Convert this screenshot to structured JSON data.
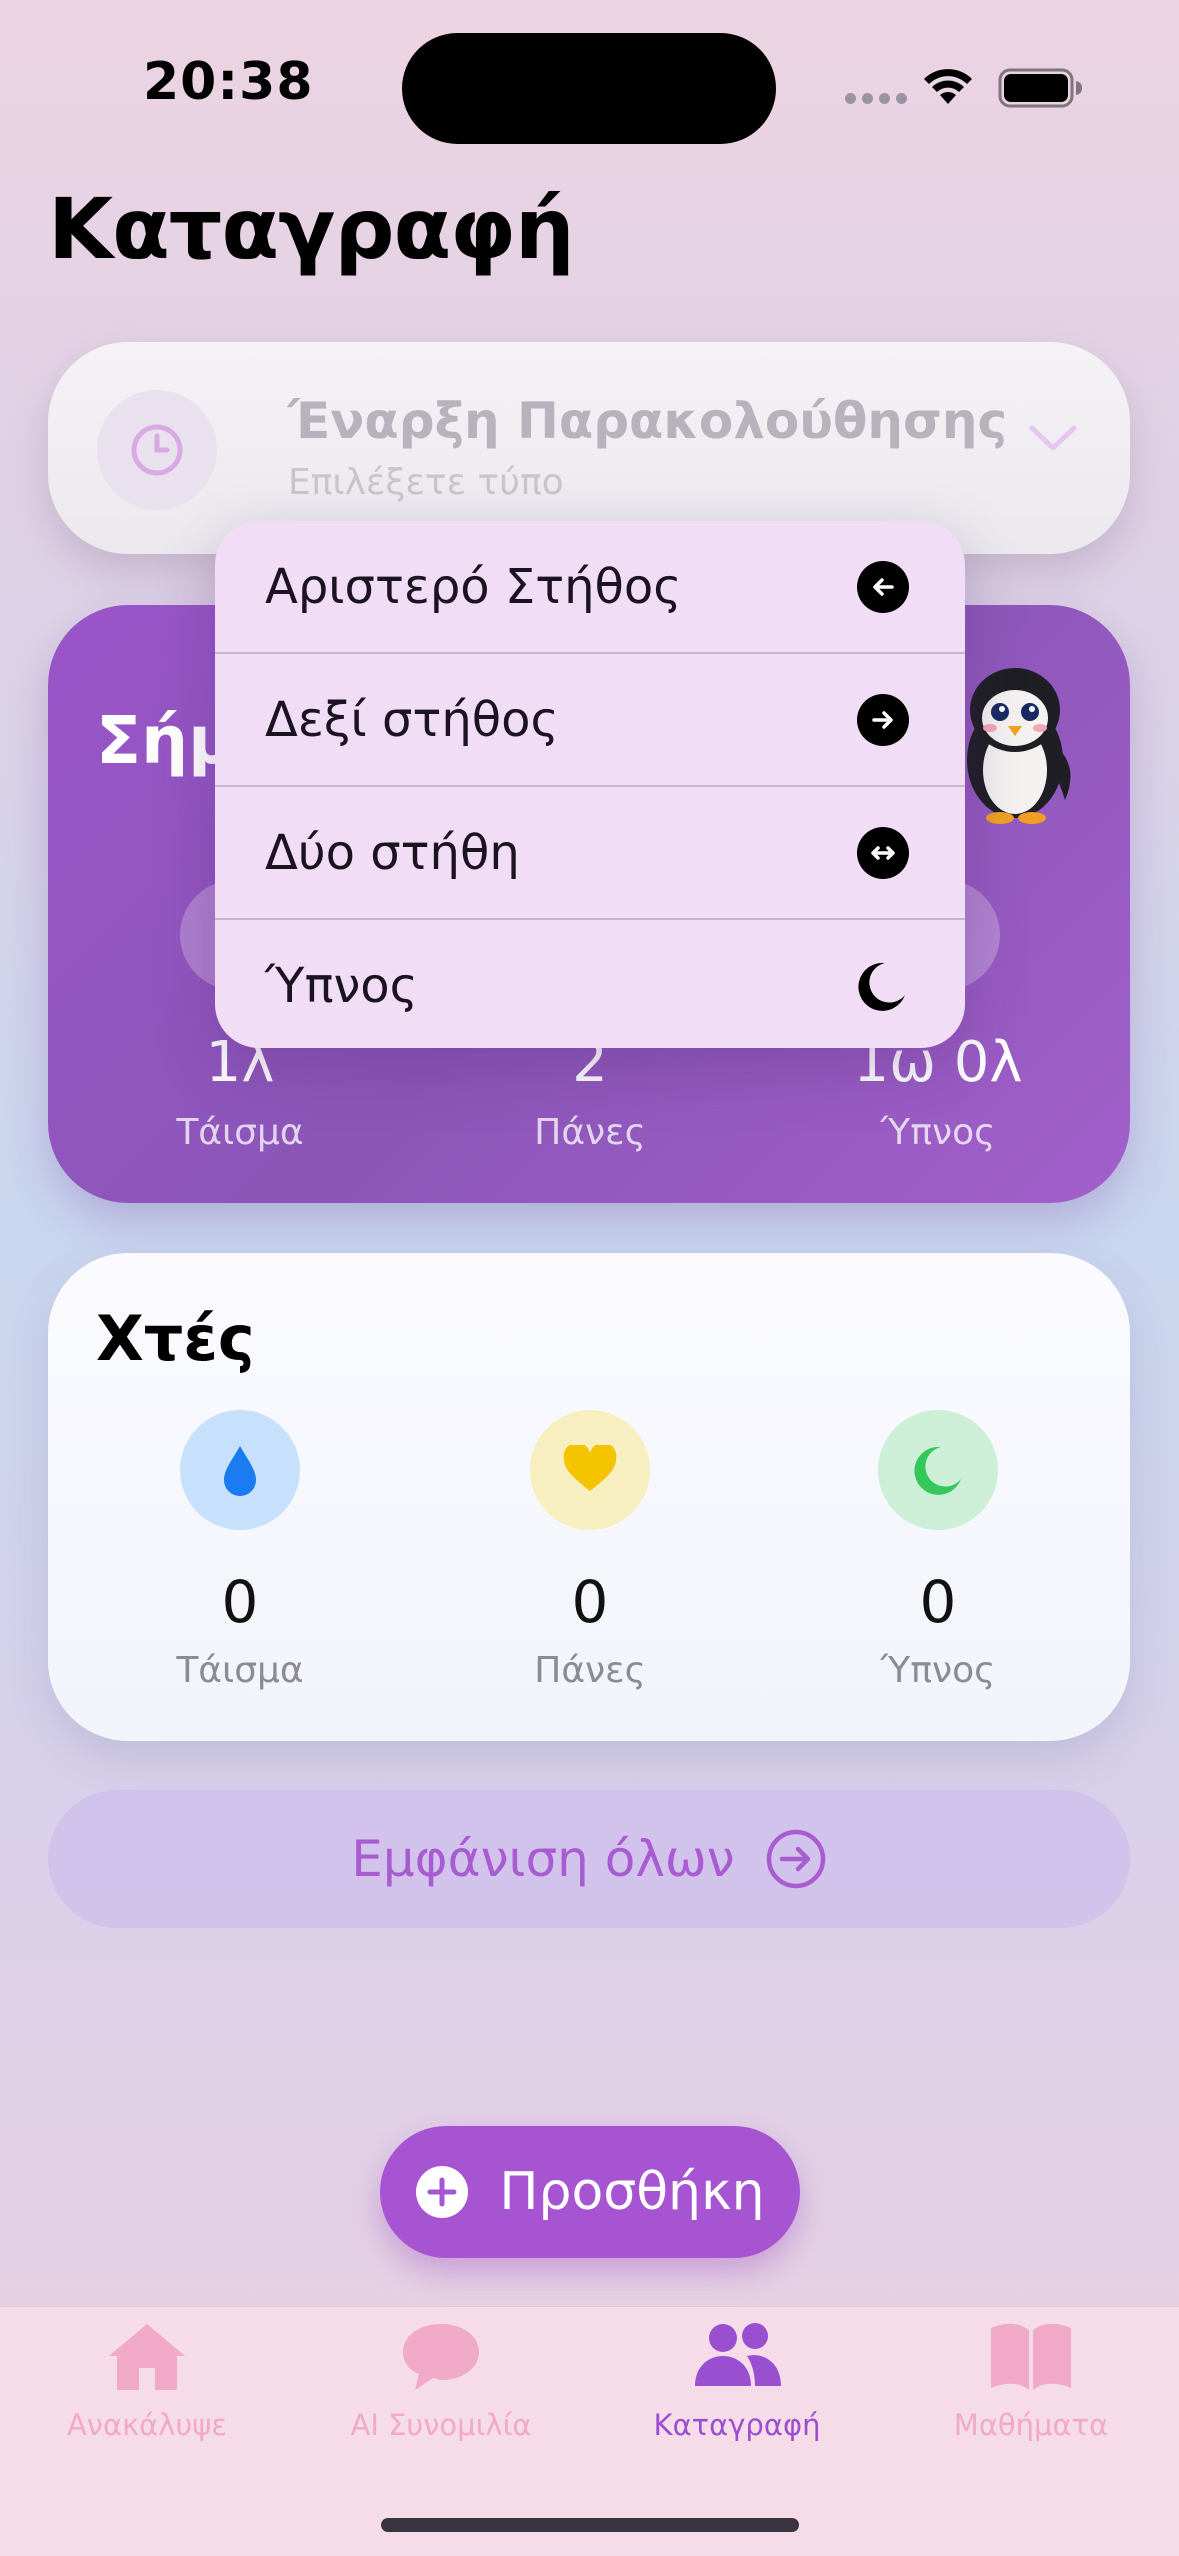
{
  "status_bar": {
    "time": "20:38"
  },
  "page": {
    "title": "Καταγραφή"
  },
  "tracking": {
    "title": "Έναρξη Παρακολούθησης",
    "subtitle": "Επιλέξετε τύπο",
    "icon": "clock-icon"
  },
  "today": {
    "title_visible": "Σήμ",
    "stats": [
      {
        "value": "1λ",
        "label": "Τάισμα"
      },
      {
        "value": "2",
        "label": "Πάνες"
      },
      {
        "value": "1ω 0λ",
        "label": "Ύπνος"
      }
    ]
  },
  "menu": {
    "items": [
      {
        "label": "Αριστερό Στήθος",
        "icon": "arrow-left-circle-icon"
      },
      {
        "label": "Δεξί στήθος",
        "icon": "arrow-right-circle-icon"
      },
      {
        "label": "Δύο στήθη",
        "icon": "arrow-left-right-circle-icon"
      },
      {
        "label": "Ύπνος",
        "icon": "moon-icon"
      }
    ]
  },
  "yesterday": {
    "title": "Χτές",
    "stats": [
      {
        "value": "0",
        "label": "Τάισμα",
        "icon": "drop-icon",
        "color": "#1a7cf0"
      },
      {
        "value": "0",
        "label": "Πάνες",
        "icon": "heart-icon",
        "color": "#f5c400"
      },
      {
        "value": "0",
        "label": "Ύπνος",
        "icon": "moon-icon",
        "color": "#34c759"
      }
    ]
  },
  "show_all": {
    "label": "Εμφάνιση όλων"
  },
  "add_button": {
    "label": "Προσθήκη"
  },
  "tabs": [
    {
      "label": "Ανακάλυψε",
      "icon": "house-icon",
      "active": false
    },
    {
      "label": "AI Συνομιλία",
      "icon": "chat-bubble-icon",
      "active": false
    },
    {
      "label": "Καταγραφή",
      "icon": "people-icon",
      "active": true
    },
    {
      "label": "Μαθήματα",
      "icon": "book-icon",
      "active": false
    }
  ],
  "colors": {
    "accent": "#a754d3",
    "tab_inactive": "#f0a9c6",
    "tab_active": "#9a4fd0"
  }
}
